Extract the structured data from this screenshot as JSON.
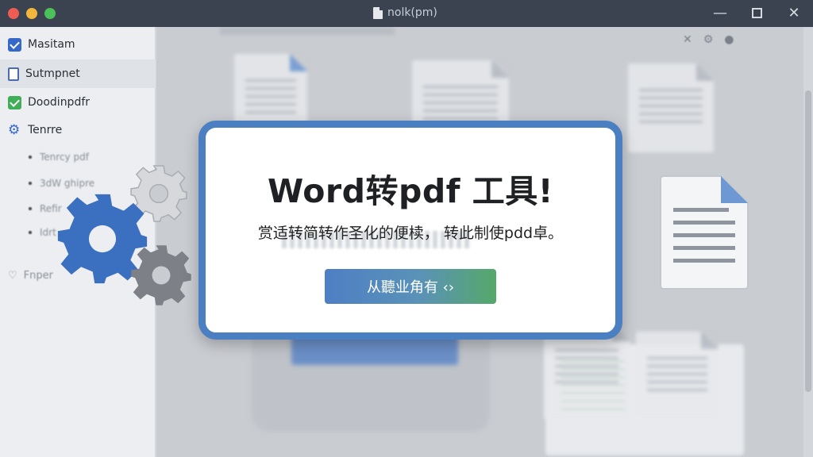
{
  "window": {
    "title": "nolk(pm)",
    "controls": {
      "minimize": "—",
      "maximize": "",
      "close": "✕"
    }
  },
  "sidebar": {
    "items": [
      {
        "label": "Masitam",
        "icon": "checkbox-icon",
        "color": "#3568c8"
      },
      {
        "label": "Sutmpnet",
        "icon": "document-icon",
        "active": true
      },
      {
        "label": "Doodinpdfr",
        "icon": "checkbox-icon",
        "color": "#3fae57"
      },
      {
        "label": "Tenrre",
        "icon": "gear-icon"
      }
    ],
    "sub_items": [
      {
        "label": "Tenrcy pdf"
      },
      {
        "label": "3dW ghipre"
      },
      {
        "label": "Refir"
      },
      {
        "label": "Idrt"
      }
    ],
    "footer_item": {
      "label": "Fnper",
      "icon": "heart-icon"
    }
  },
  "dialog": {
    "title": "Word转pdf 工具!",
    "subtitle": "赏适转简转作圣化的便椟，   转此制使pdd卓。",
    "button_label": "从聽业角有 ‹›",
    "border_color": "#4a7fc1"
  },
  "colors": {
    "accent_blue": "#4a7fc1",
    "gear_blue": "#3b6fc0",
    "gear_gray": "#8f9297",
    "button_green": "#56a86a"
  }
}
